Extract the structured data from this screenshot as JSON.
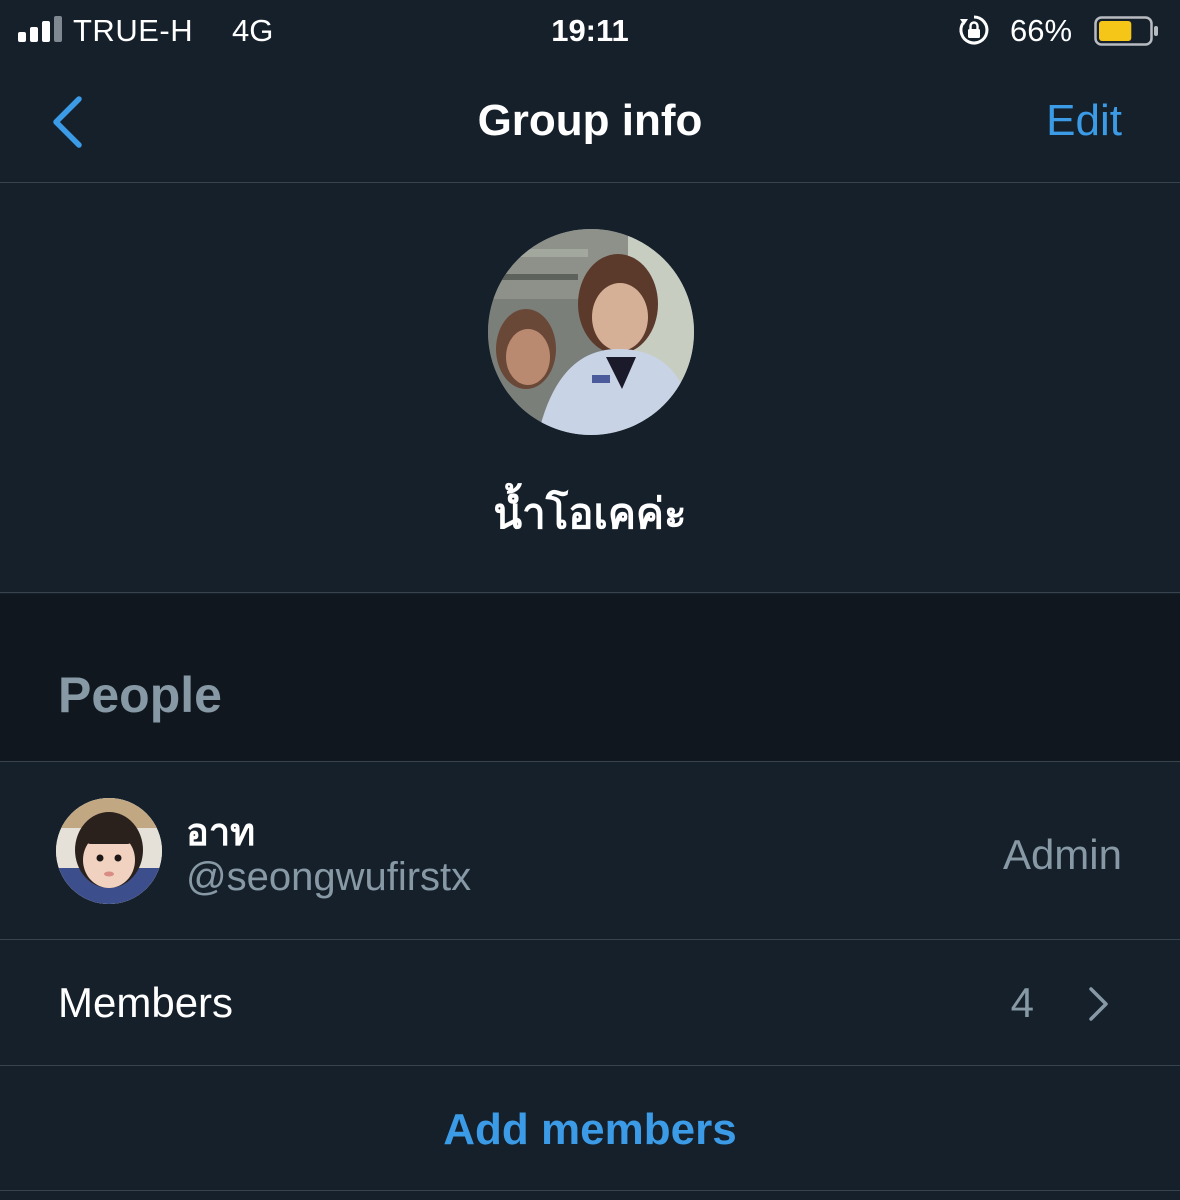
{
  "status_bar": {
    "carrier": "TRUE-H",
    "network": "4G",
    "time": "19:11",
    "battery_percent": "66%",
    "battery_level": 0.66,
    "battery_color": "#f5c518"
  },
  "nav": {
    "title": "Group info",
    "edit_label": "Edit",
    "back_icon": "chevron-left-icon"
  },
  "group": {
    "name": "น้ำโอเคค่ะ"
  },
  "people_section": {
    "title": "People"
  },
  "members": [
    {
      "name": "อาท",
      "handle": "@seongwufirstx",
      "role": "Admin"
    }
  ],
  "members_row": {
    "label": "Members",
    "count": "4"
  },
  "add_members": {
    "label": "Add members"
  },
  "colors": {
    "background": "#15202b",
    "section_background": "#10171e",
    "accent": "#3b9be6",
    "secondary_text": "#8899a6",
    "divider": "#38444d"
  }
}
